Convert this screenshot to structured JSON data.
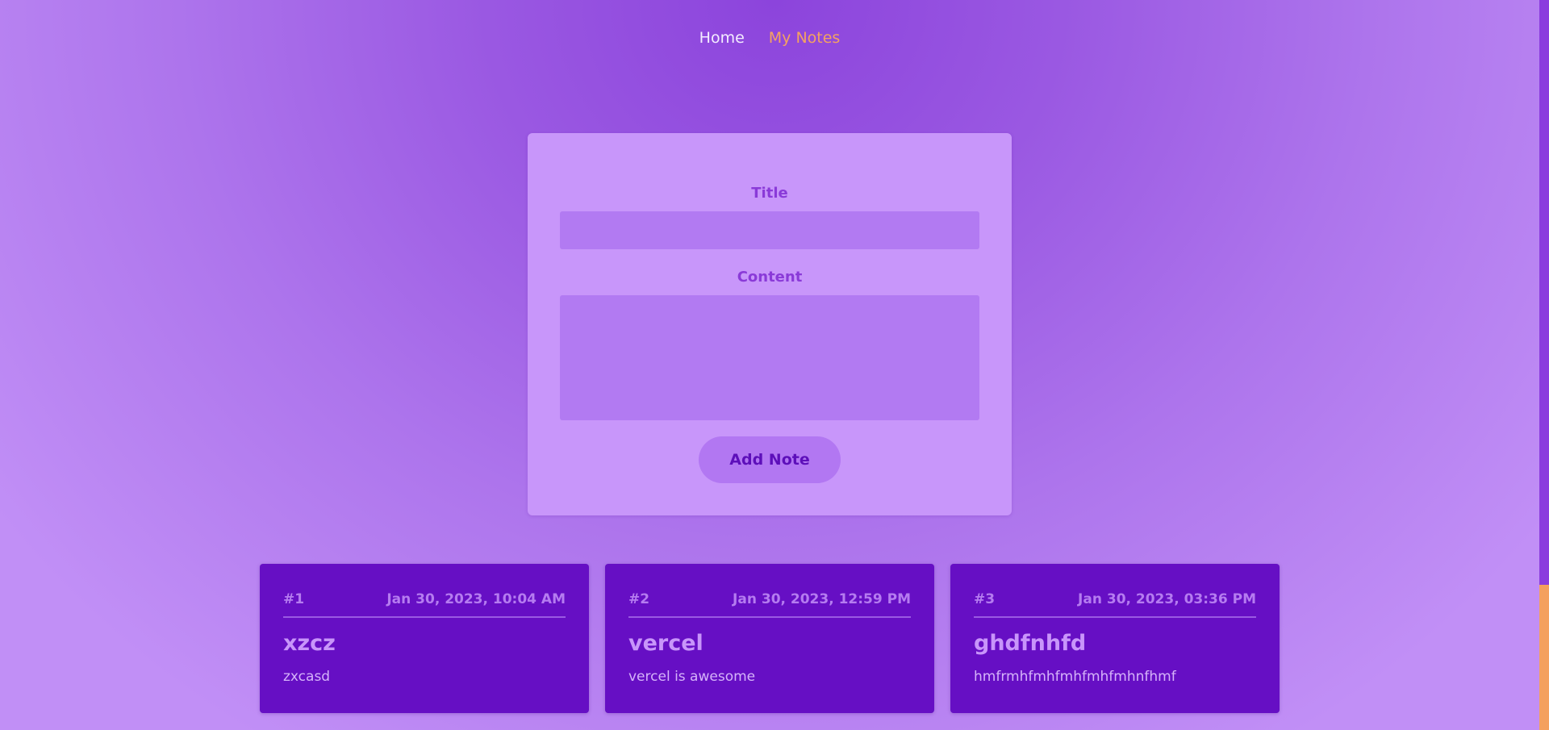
{
  "nav": {
    "items": [
      {
        "label": "Home",
        "active": false
      },
      {
        "label": "My Notes",
        "active": true
      }
    ]
  },
  "form": {
    "title_label": "Title",
    "title_value": "",
    "content_label": "Content",
    "content_value": "",
    "submit_label": "Add Note"
  },
  "notes": [
    {
      "number": "#1",
      "date": "Jan 30, 2023, 10:04 AM",
      "title": "xzcz",
      "content": "zxcasd"
    },
    {
      "number": "#2",
      "date": "Jan 30, 2023, 12:59 PM",
      "title": "vercel",
      "content": "vercel is awesome"
    },
    {
      "number": "#3",
      "date": "Jan 30, 2023, 03:36 PM",
      "title": "ghdfnhfd",
      "content": "hmfrmhfmhfmhfmhfmhnfhmf"
    }
  ],
  "colors": {
    "background": "#9a58e2",
    "form_card": "#c896fa",
    "input": "#b27af2",
    "note_card": "#660fc4",
    "nav_active": "#f4a260",
    "nav_inactive": "#f4ecff",
    "scroll_thumb": "#f4a05e"
  }
}
